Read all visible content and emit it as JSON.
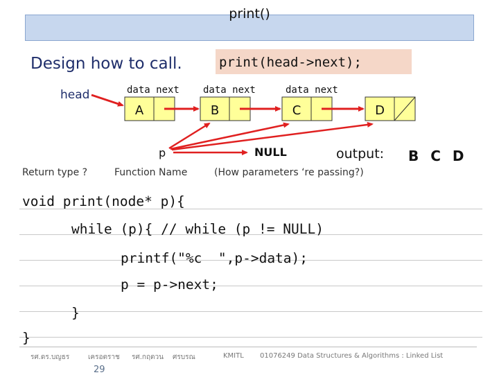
{
  "slide": {
    "title": "print()",
    "subtitle": "Design how to call.",
    "call": "print(head->next);"
  },
  "diagram": {
    "head_label": "head",
    "p_label": "p",
    "null_label": "NULL",
    "field_headers": [
      "data next",
      "data next",
      "data next"
    ],
    "nodes": [
      {
        "data": "A"
      },
      {
        "data": "B"
      },
      {
        "data": "C"
      },
      {
        "data": "D"
      }
    ],
    "node_fill": "#ffff99",
    "arrow_color": "#e02020"
  },
  "output": {
    "label": "output:",
    "value": "B C D"
  },
  "annotations": {
    "return_type": "Return type ?",
    "function_name": "Function Name",
    "params": "(How parameters ‘re passing?)"
  },
  "code": [
    "void print(node* p){",
    "while (p){ // while (p != NULL)",
    "printf(\"%c  \",p->data);",
    "p = p->next;",
    "}",
    "}"
  ],
  "footer": {
    "author1": "รศ.ดร.บญธร",
    "author2": "เครอตราช",
    "author3": "รศ.กฤตวน",
    "author4": "ศรบรณ",
    "institute": "KMITL",
    "course": "01076249 Data Structures & Algorithms : Linked List",
    "page": "29"
  }
}
